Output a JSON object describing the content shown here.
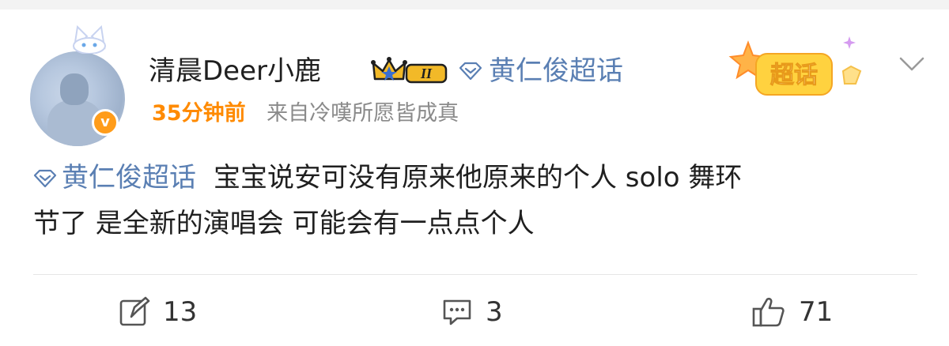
{
  "post": {
    "username": "清晨Deer小鹿",
    "level_badge": "II",
    "header_topic": "黄仁俊超话",
    "time": "35分钟前",
    "source": "来自冷嘆所愿皆成真",
    "sticker_text": "超话",
    "topic_tag": "黄仁俊超话",
    "text_line1": "宝宝说安可没有原来他原来的个人 solo 舞环",
    "text_line2": "节了 是全新的演唱会 可能会有一点点个人",
    "avatar_badge": "v"
  },
  "actions": {
    "repost_count": "13",
    "comment_count": "3",
    "like_count": "71"
  },
  "colors": {
    "link_blue": "#5a7fb3",
    "time_orange": "#ff8a00",
    "muted_gray": "#8a8a8a"
  },
  "icons": [
    "cat-ears-icon",
    "crown-level-icon",
    "diamond-icon",
    "chaohua-sticker-icon",
    "chevron-down-icon",
    "repost-icon",
    "comment-icon",
    "like-icon"
  ]
}
